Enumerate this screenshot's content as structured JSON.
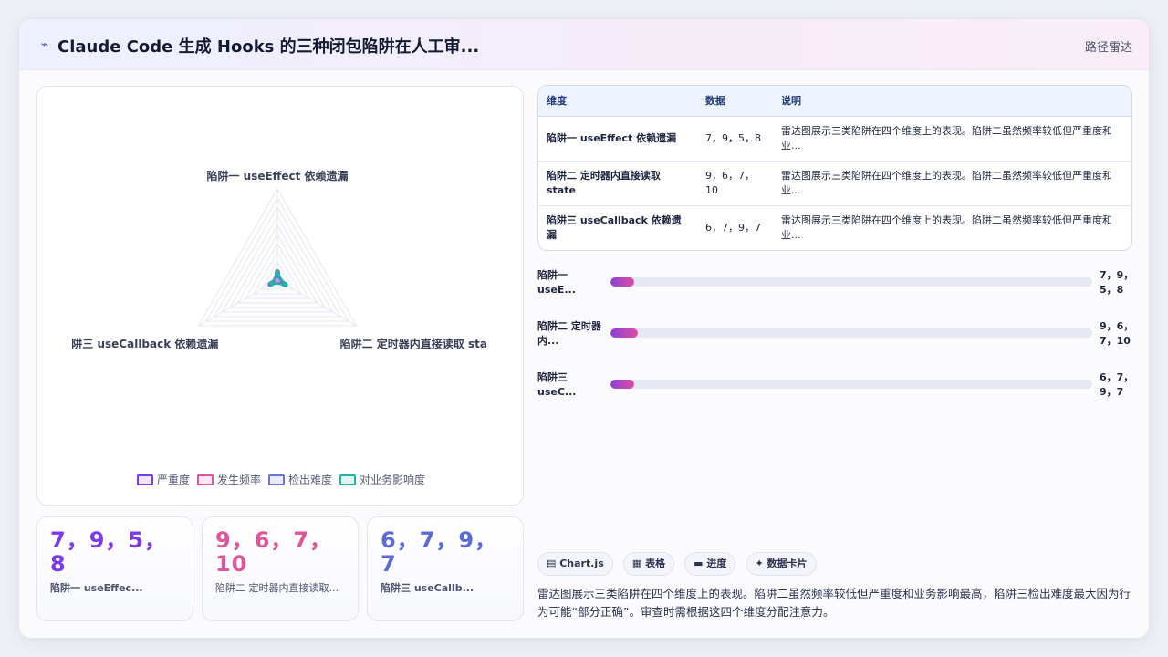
{
  "header": {
    "title": "Claude Code 生成 Hooks 的三种闭包陷阱在人工审...",
    "kind": "路径雷达"
  },
  "chart_data": {
    "type": "radar",
    "axes": [
      "陷阱一 useEffect 依赖遗漏",
      "陷阱二 定时器内直接读取 state",
      "陷阱三 useCallback 依赖遗漏"
    ],
    "axis_labels_shown": [
      "陷阱一 useEffect 依赖遗漏",
      "陷阱二 定时器内直接读取 sta",
      "阱三 useCallback 依赖遗漏"
    ],
    "series": [
      {
        "name": "严重度",
        "values": [
          7,
          9,
          6
        ],
        "color": "#7c3aed"
      },
      {
        "name": "发生频率",
        "values": [
          9,
          6,
          7
        ],
        "color": "#e0559a"
      },
      {
        "name": "检出难度",
        "values": [
          5,
          7,
          9
        ],
        "color": "#6b72d9"
      },
      {
        "name": "对业务影响度",
        "values": [
          8,
          10,
          7
        ],
        "color": "#20b7a4"
      }
    ],
    "legend_position": "bottom",
    "grid": true
  },
  "cards": [
    {
      "value": "7，9，5，8",
      "label": "陷阱一 useEffec...",
      "color": "#7c3aed"
    },
    {
      "value": "9，6，7，10",
      "label": "陷阱二 定时器内直接读取...",
      "color": "#e0559a"
    },
    {
      "value": "6，7，9，7",
      "label": "陷阱三 useCallb...",
      "color": "#5b6bd6"
    }
  ],
  "table": {
    "headers": [
      "维度",
      "数据",
      "说明"
    ],
    "rows": [
      [
        "陷阱一 useEffect 依赖遗漏",
        "7，9，5，8",
        "雷达图展示三类陷阱在四个维度上的表现。陷阱二虽然频率较低但严重度和业..."
      ],
      [
        "陷阱二 定时器内直接读取 state",
        "9，6，7，10",
        "雷达图展示三类陷阱在四个维度上的表现。陷阱二虽然频率较低但严重度和业..."
      ],
      [
        "陷阱三 useCallback 依赖遗漏",
        "6，7，9，7",
        "雷达图展示三类陷阱在四个维度上的表现。陷阱二虽然频率较低但严重度和业..."
      ]
    ]
  },
  "progress": [
    {
      "label": "陷阱一 useE...",
      "value": "7，9，5，8",
      "fraction": 0.05
    },
    {
      "label": "陷阱二 定时器内...",
      "value": "9，6，7，10",
      "fraction": 0.056
    },
    {
      "label": "陷阱三 useC...",
      "value": "6，7，9，7",
      "fraction": 0.05
    }
  ],
  "tags": [
    "Chart.js",
    "表格",
    "进度",
    "数据卡片"
  ],
  "tag_icons": [
    "chart-icon",
    "table-icon",
    "progress-icon",
    "card-icon"
  ],
  "description": "雷达图展示三类陷阱在四个维度上的表现。陷阱二虽然频率较低但严重度和业务影响最高，陷阱三检出难度最大因为行为可能“部分正确”。审查时需根据这四个维度分配注意力。"
}
